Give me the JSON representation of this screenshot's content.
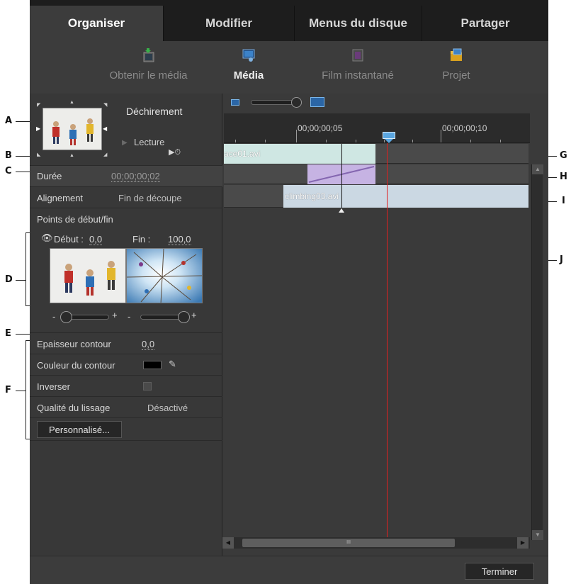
{
  "tabs": [
    {
      "label": "Organiser",
      "active": true
    },
    {
      "label": "Modifier",
      "active": false
    },
    {
      "label": "Menus du disque",
      "active": false
    },
    {
      "label": "Partager",
      "active": false
    }
  ],
  "toolbar": [
    {
      "label": "Obtenir le média",
      "icon": "get-media-icon",
      "active": false
    },
    {
      "label": "Média",
      "icon": "media-icon",
      "active": true
    },
    {
      "label": "Film instantané",
      "icon": "instant-movie-icon",
      "active": false
    },
    {
      "label": "Projet",
      "icon": "project-icon",
      "active": false
    }
  ],
  "effect": {
    "name": "Déchirement",
    "play_label": "Lecture"
  },
  "properties": {
    "duration_label": "Durée",
    "duration_value": "00;00;00;02",
    "alignment_label": "Alignement",
    "alignment_value": "Fin de découpe",
    "start_end_label": "Points de début/fin",
    "start_label": "Début :",
    "start_value": "0,0",
    "end_label": "Fin :",
    "end_value": "100,0",
    "slider_minus": "-",
    "slider_plus": "+",
    "border_width_label": "Epaisseur contour",
    "border_width_value": "0,0",
    "border_color_label": "Couleur du contour",
    "border_color": "#000000",
    "reverse_label": "Inverser",
    "smoothing_label": "Qualité du lissage",
    "smoothing_value": "Désactivé",
    "custom_button": "Personnalisé..."
  },
  "timeline": {
    "timecodes": [
      "00;00;00;05",
      "00;00;00;10"
    ],
    "clips": [
      {
        "name": "race01.avi",
        "color": "#cfe7e3"
      },
      {
        "name": "climbing03.avi",
        "color": "#cbd8e3"
      }
    ],
    "transition_color": "#c6b3e3",
    "playhead_color": "#e02020",
    "scroll_grip": "III"
  },
  "footer": {
    "done_button": "Terminer"
  },
  "callouts": [
    "A",
    "B",
    "C",
    "D",
    "E",
    "F",
    "G",
    "H",
    "I",
    "J"
  ]
}
